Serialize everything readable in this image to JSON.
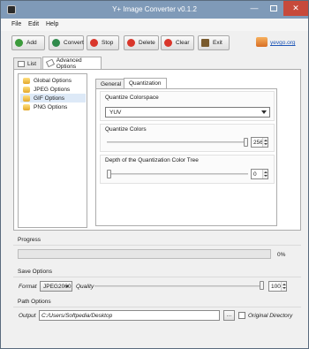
{
  "window": {
    "title": "Y+ Image Converter v0.1.2",
    "minimize": "—",
    "close": "✕"
  },
  "menu": [
    "File",
    "Edit",
    "Help"
  ],
  "toolbar": {
    "buttons": [
      {
        "label": "Add",
        "icon": "add-icon",
        "color": "#3c9b3c"
      },
      {
        "label": "Convert",
        "icon": "convert-icon",
        "color": "#2f8a4b"
      },
      {
        "label": "Stop",
        "icon": "stop-icon",
        "color": "#d9362b"
      },
      {
        "label": "Delete",
        "icon": "delete-icon",
        "color": "#d9362b"
      },
      {
        "label": "Clear",
        "icon": "clear-icon",
        "color": "#d9362b"
      },
      {
        "label": "Exit",
        "icon": "exit-icon",
        "color": "#7a5b2e"
      }
    ],
    "link": "yevgo.org"
  },
  "tabs": [
    "List",
    "Advanced Options"
  ],
  "formats": [
    "Global Options",
    "JPEG Options",
    "GIF Options",
    "PNG Options"
  ],
  "selected_format_index": 2,
  "subtabs": [
    "General",
    "Quantization"
  ],
  "quantization": {
    "colorspace_label": "Quantize Colorspace",
    "colorspace_value": "YUV",
    "colors_label": "Quantize Colors",
    "colors_value": "256",
    "colors_level": 1.0,
    "depth_label": "Depth of the Quantization Color Tree",
    "depth_value": "0",
    "depth_level": 0.0
  },
  "progress": {
    "title": "Progress",
    "value": 0,
    "text": "0%"
  },
  "save_options": {
    "title": "Save Options",
    "format_label": "Format",
    "format_value": "JPEG2000",
    "quality_label": "Quality",
    "quality_value": "100",
    "quality_level": 1.0
  },
  "path_options": {
    "title": "Path Options",
    "output_label": "Output",
    "output_value": "C:/Users/Softpedia/Desktop",
    "browse_label": "...",
    "original_dir_label": "Original Directory",
    "original_dir_checked": false
  },
  "colors": {
    "titlebar": "#7f9ab8",
    "progress_fill": "#06b025",
    "selection": "#dde9f7",
    "link": "#1f57b8"
  }
}
